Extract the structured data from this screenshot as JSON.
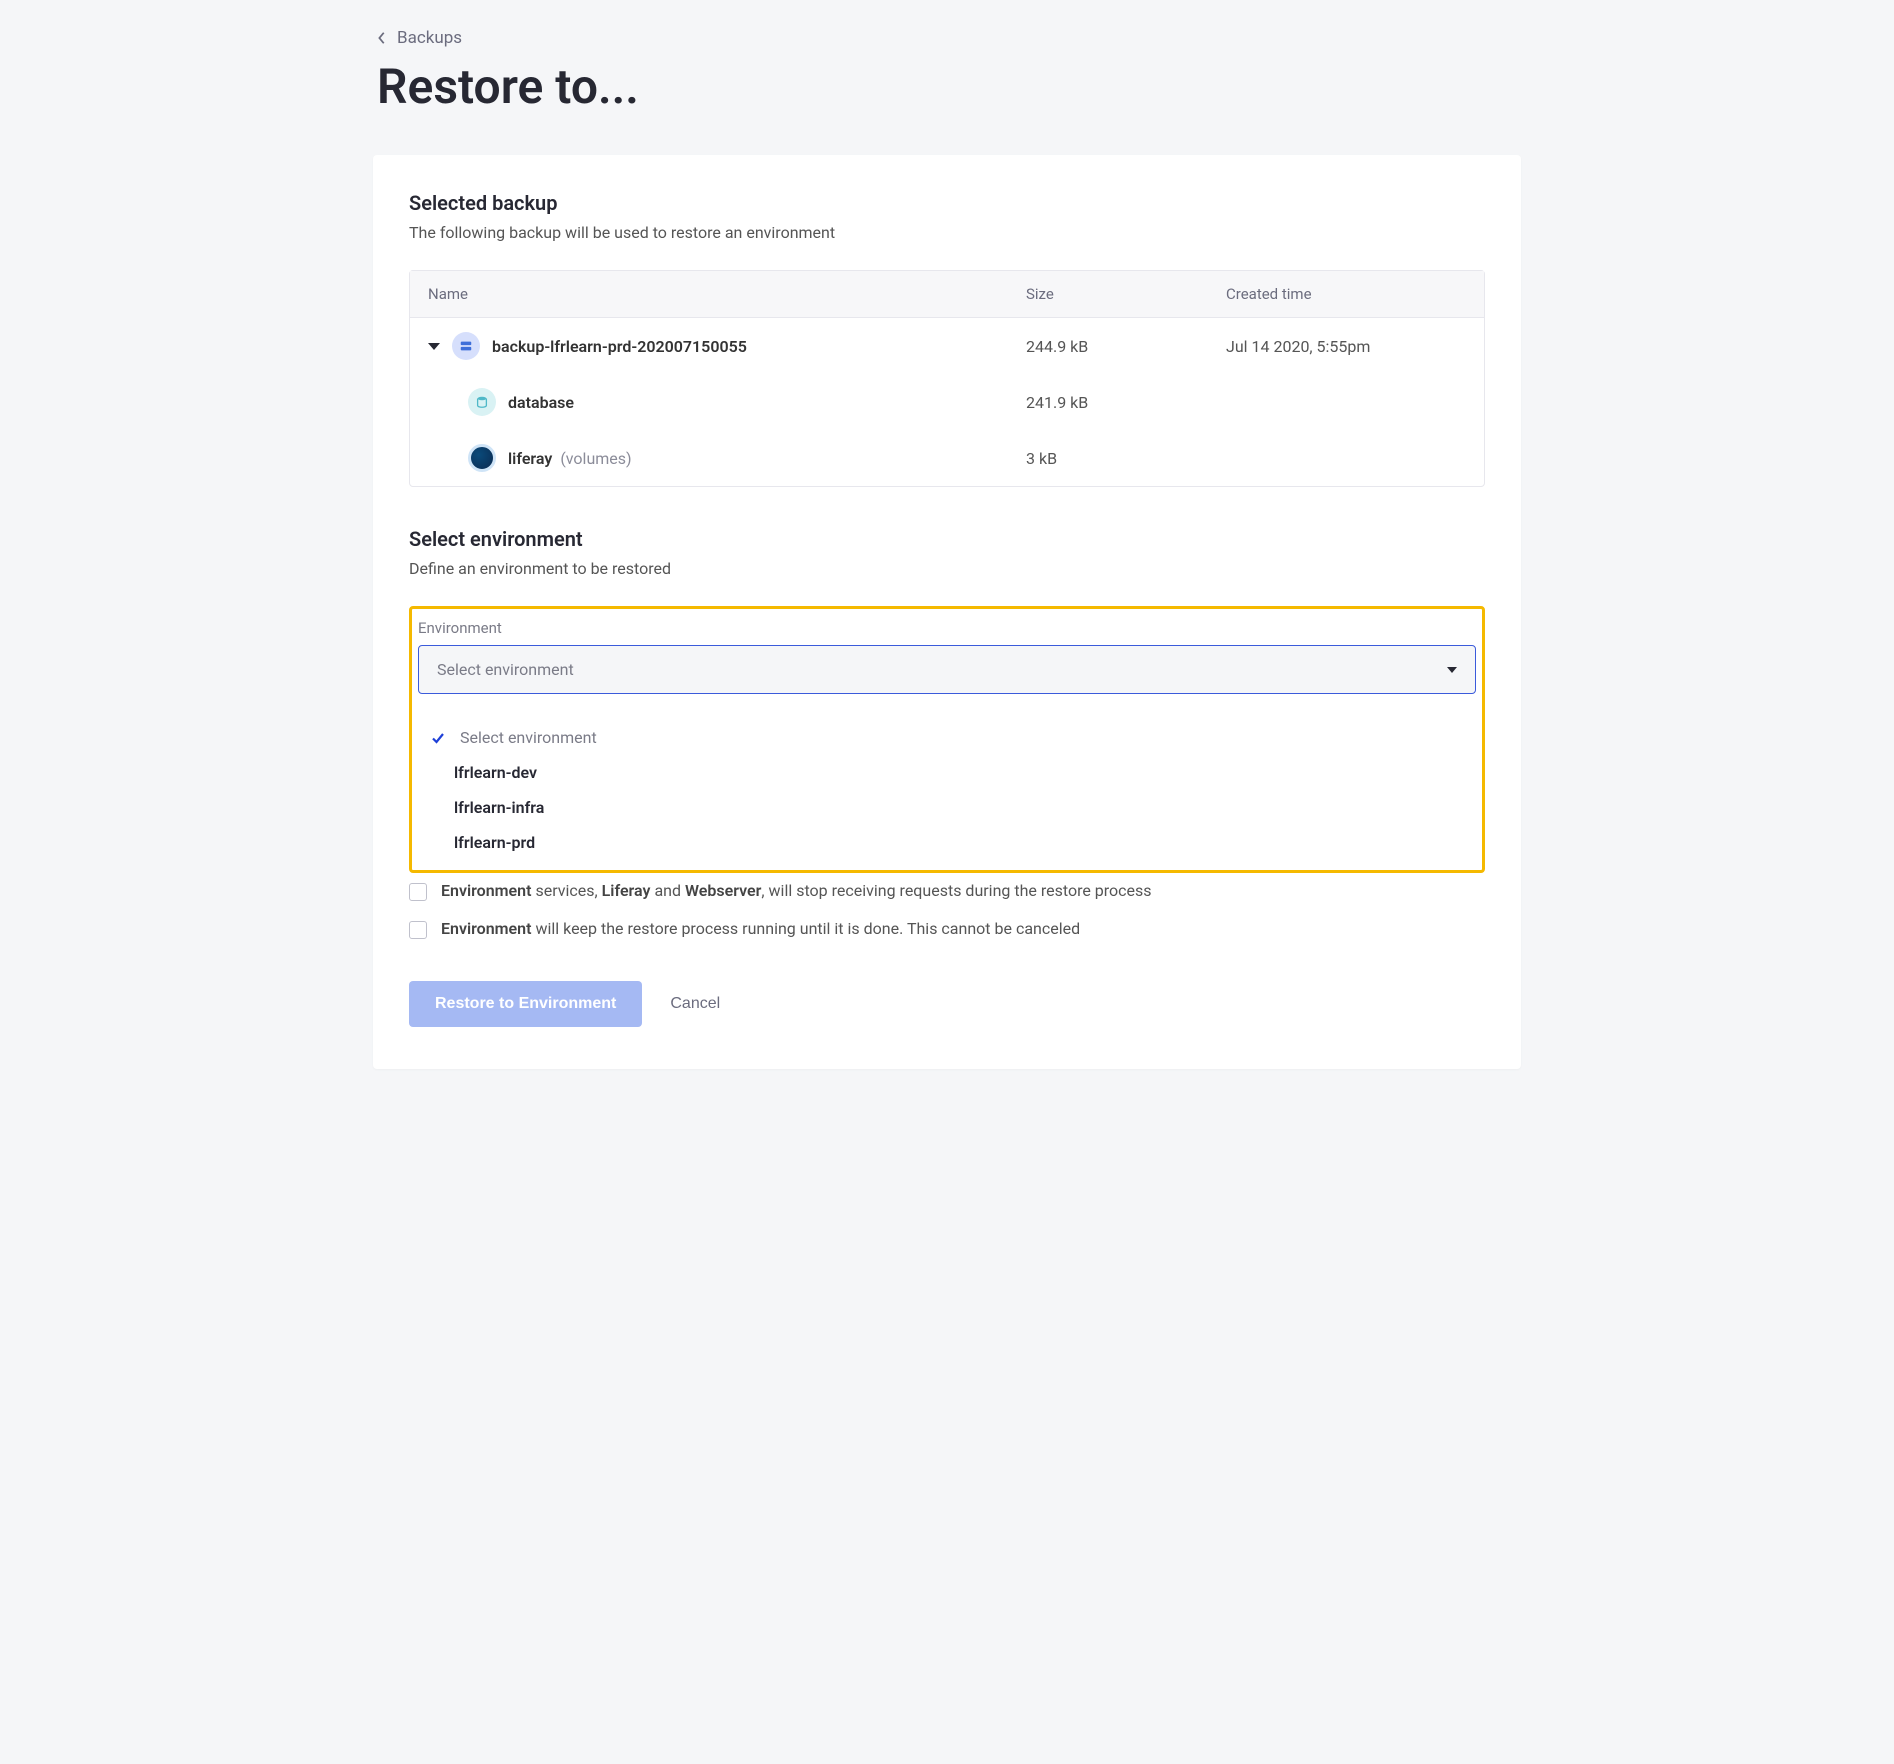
{
  "breadcrumb": {
    "label": "Backups"
  },
  "page_title": "Restore to...",
  "selected_backup": {
    "title": "Selected backup",
    "desc": "The following backup will be used to restore an environment",
    "columns": {
      "name": "Name",
      "size": "Size",
      "created": "Created time"
    },
    "backup": {
      "name": "backup-lfrlearn-prd-202007150055",
      "size": "244.9 kB",
      "created": "Jul 14 2020, 5:55pm",
      "children": [
        {
          "name": "database",
          "suffix": "",
          "size": "241.9 kB",
          "icon": "db"
        },
        {
          "name": "liferay",
          "suffix": "(volumes)",
          "size": "3 kB",
          "icon": "liferay"
        }
      ]
    }
  },
  "select_env": {
    "title": "Select environment",
    "desc": "Define an environment to be restored",
    "field_label": "Environment",
    "placeholder": "Select environment",
    "options": [
      {
        "label": "Select environment",
        "selected": true,
        "placeholder": true
      },
      {
        "label": "lfrlearn-dev"
      },
      {
        "label": "lfrlearn-infra"
      },
      {
        "label": "lfrlearn-prd"
      }
    ]
  },
  "confirmations": {
    "row1_pre": "Environment",
    "row1_mid": " services, ",
    "row1_b1": "Liferay",
    "row1_and": " and ",
    "row1_b2": "Webserver",
    "row1_post": ", will stop receiving requests during the restore process",
    "row2_pre": "Environment",
    "row2_post": " will keep the restore process running until it is done. This cannot be canceled"
  },
  "actions": {
    "primary": "Restore to Environment",
    "cancel": "Cancel"
  }
}
